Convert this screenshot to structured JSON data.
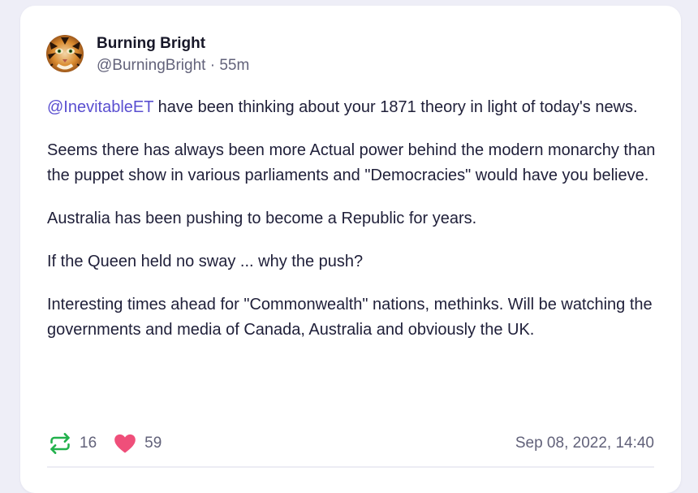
{
  "post": {
    "author": {
      "display_name": "Burning Bright",
      "handle": "@BurningBright",
      "separator": "·",
      "age": "55m",
      "avatar_icon": "tiger-avatar"
    },
    "mention": "@InevitableET",
    "paragraphs": [
      " have been thinking about your 1871 theory in light of today's news.",
      "Seems there has always been more Actual power behind the modern monarchy than the puppet show in various parliaments and \"Democracies\" would have you believe.",
      "Australia has been pushing to become a Republic for years.",
      "If the Queen held no sway ... why the push?",
      "Interesting times ahead for \"Commonwealth\" nations, methinks. Will be watching the governments and media of Canada, Australia and obviously the UK."
    ],
    "stats": {
      "reposts": "16",
      "likes": "59"
    },
    "timestamp": "Sep 08, 2022, 14:40"
  },
  "colors": {
    "page_background": "#eeeef7",
    "mention": "#5a4fd0",
    "repost_icon": "#22b14c",
    "like_icon": "#ef4f7a",
    "muted_text": "#62627a"
  },
  "icons": {
    "repost": "repost-icon",
    "like": "heart-icon"
  }
}
